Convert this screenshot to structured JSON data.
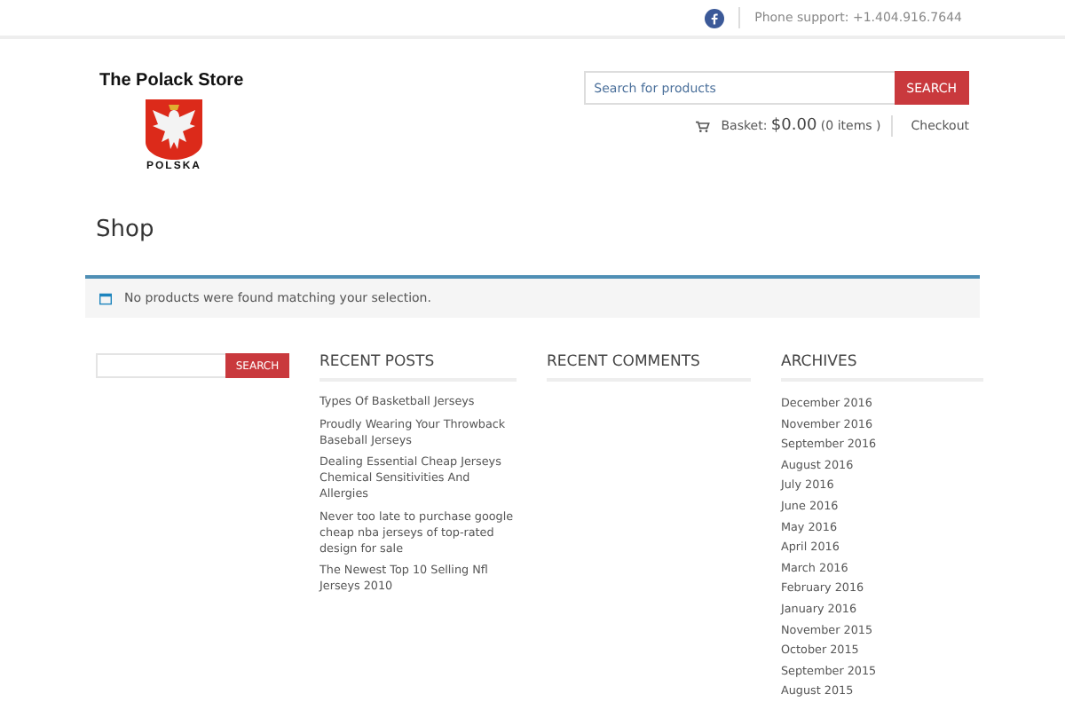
{
  "topbar": {
    "phone": "Phone support: +1.404.916.7644"
  },
  "header": {
    "site_title": "The Polack Store",
    "logo_text": "POLSKA",
    "search": {
      "placeholder": "Search for products",
      "button": "SEARCH"
    },
    "basket": {
      "label": "Basket:",
      "amount": "$0.00",
      "items": "(0 items )"
    },
    "checkout": "Checkout"
  },
  "page_title": "Shop",
  "notice": "No products were found matching your selection.",
  "sidebar_search": {
    "button": "SEARCH"
  },
  "recent_posts": {
    "title": "RECENT POSTS",
    "items": [
      "Types Of Basketball Jerseys",
      "Proudly Wearing Your Throwback Baseball Jerseys",
      "Dealing Essential Cheap Jerseys Chemical Sensitivities And Allergies",
      "Never too late to purchase google cheap nba jerseys of top-rated design for sale",
      "The Newest Top 10 Selling Nfl Jerseys 2010"
    ]
  },
  "recent_comments": {
    "title": "RECENT COMMENTS"
  },
  "archives": {
    "title": "ARCHIVES",
    "items": [
      "December 2016",
      "November 2016",
      "September 2016",
      "August 2016",
      "July 2016",
      "June 2016",
      "May 2016",
      "April 2016",
      "March 2016",
      "February 2016",
      "January 2016",
      "November 2015",
      "October 2015",
      "September 2015",
      "August 2015"
    ]
  }
}
